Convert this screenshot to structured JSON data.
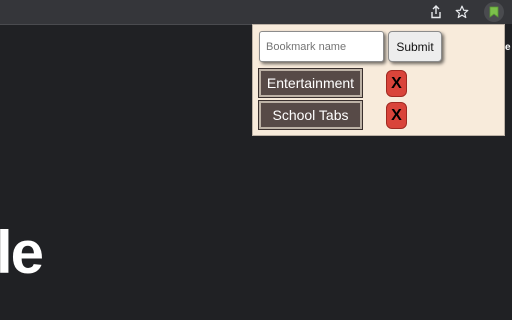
{
  "browser": {
    "toolbar_icons": [
      "share-icon",
      "star-icon",
      "bookmark-extension-icon"
    ]
  },
  "page": {
    "logo_fragment": "le",
    "edge_text": "e"
  },
  "popup": {
    "input_placeholder": "Bookmark name",
    "input_value": "",
    "submit_label": "Submit",
    "bookmarks": [
      {
        "label": "Entertainment",
        "delete_label": "X"
      },
      {
        "label": "School Tabs",
        "delete_label": "X"
      }
    ]
  }
}
